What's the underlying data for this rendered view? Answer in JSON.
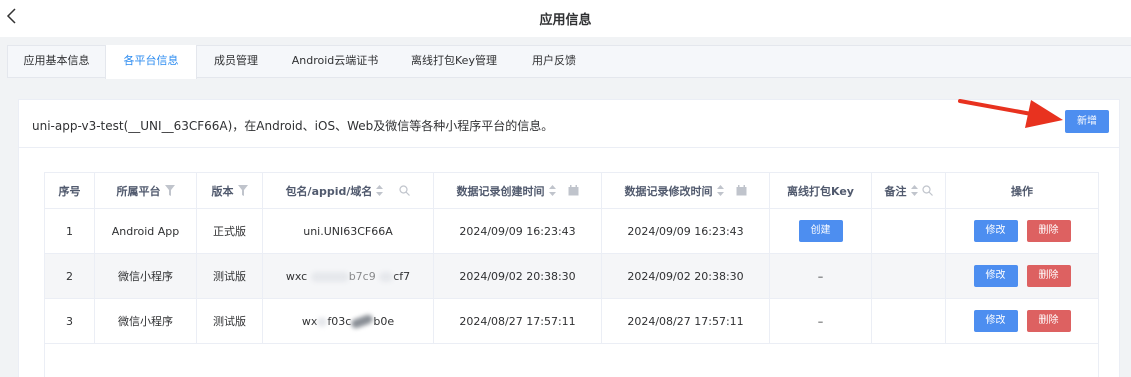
{
  "header": {
    "title": "应用信息",
    "back_icon": "chevron-left-icon"
  },
  "tabs": [
    {
      "label": "应用基本信息",
      "active": false
    },
    {
      "label": "各平台信息",
      "active": true
    },
    {
      "label": "成员管理",
      "active": false
    },
    {
      "label": "Android云端证书",
      "active": false
    },
    {
      "label": "离线打包Key管理",
      "active": false
    },
    {
      "label": "用户反馈",
      "active": false
    }
  ],
  "panel": {
    "description": "uni-app-v3-test(__UNI__63CF66A)，在Android、iOS、Web及微信等各种小程序平台的信息。",
    "add_label": "新增"
  },
  "table": {
    "columns": {
      "index": "序号",
      "platform": "所属平台",
      "version": "版本",
      "package": "包名/appid/域名",
      "created": "数据记录创建时间",
      "modified": "数据记录修改时间",
      "offline_key": "离线打包Key",
      "remark": "备注",
      "actions": "操作"
    },
    "rows": [
      {
        "index": "1",
        "platform": "Android App",
        "version": "正式版",
        "package": "uni.UNI63CF66A",
        "created": "2024/09/09 16:23:43",
        "modified": "2024/09/09 16:23:43",
        "offline_key": "创建",
        "remark": ""
      },
      {
        "index": "2",
        "platform": "微信小程序",
        "version": "测试版",
        "package_prefix": "wxc",
        "package_mid": "b7c9",
        "package_suffix": "cf7",
        "created": "2024/09/02 20:38:30",
        "modified": "2024/09/02 20:38:30",
        "offline_key": "–",
        "remark": ""
      },
      {
        "index": "3",
        "platform": "微信小程序",
        "version": "测试版",
        "package_prefix": "wx",
        "package_mid": "f03c",
        "package_suffix": "b0e",
        "created": "2024/08/27 17:57:11",
        "modified": "2024/08/27 17:57:11",
        "offline_key": "–",
        "remark": ""
      }
    ],
    "edit_label": "修改",
    "delete_label": "删除"
  },
  "colors": {
    "primary": "#4d8ef0",
    "danger": "#dd6161",
    "active_tab": "#2d8cf0",
    "annotation_arrow": "#e8321f"
  }
}
